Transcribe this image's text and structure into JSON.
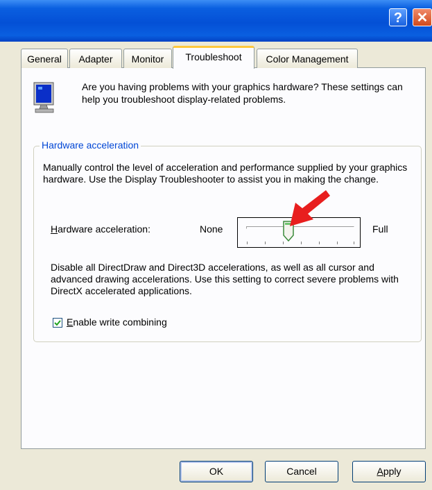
{
  "titlebar": {
    "help_glyph": "?",
    "close_glyph": "✕"
  },
  "tabs": [
    {
      "label": "General",
      "active": false
    },
    {
      "label": "Adapter",
      "active": false
    },
    {
      "label": "Monitor",
      "active": false
    },
    {
      "label": "Troubleshoot",
      "active": true
    },
    {
      "label": "Color Management",
      "active": false
    }
  ],
  "intro_text": "Are you having problems with your graphics hardware? These settings can help you troubleshoot display-related problems.",
  "group": {
    "title": "Hardware acceleration",
    "description": "Manually control the level of acceleration and performance supplied by your graphics hardware. Use the Display Troubleshooter to assist you in making the change.",
    "slider_label_prefix": "H",
    "slider_label_rest": "ardware acceleration:",
    "min_label": "None",
    "max_label": "Full",
    "slider_level_fraction": 0.33,
    "level_description": "Disable all DirectDraw and Direct3D accelerations, as well as all cursor and advanced drawing accelerations. Use this setting to correct severe problems with DirectX accelerated applications.",
    "checkbox_prefix": "E",
    "checkbox_rest": "nable write combining",
    "checkbox_checked": true
  },
  "buttons": {
    "ok": "OK",
    "cancel": "Cancel",
    "apply_prefix": "A",
    "apply_rest": "pply"
  },
  "colors": {
    "arrow": "#e81e1e",
    "accent": "#0046d5",
    "title_bar": "#0450d6"
  },
  "icons": {
    "monitor": "monitor-icon",
    "arrow": "red-arrow-icon"
  }
}
